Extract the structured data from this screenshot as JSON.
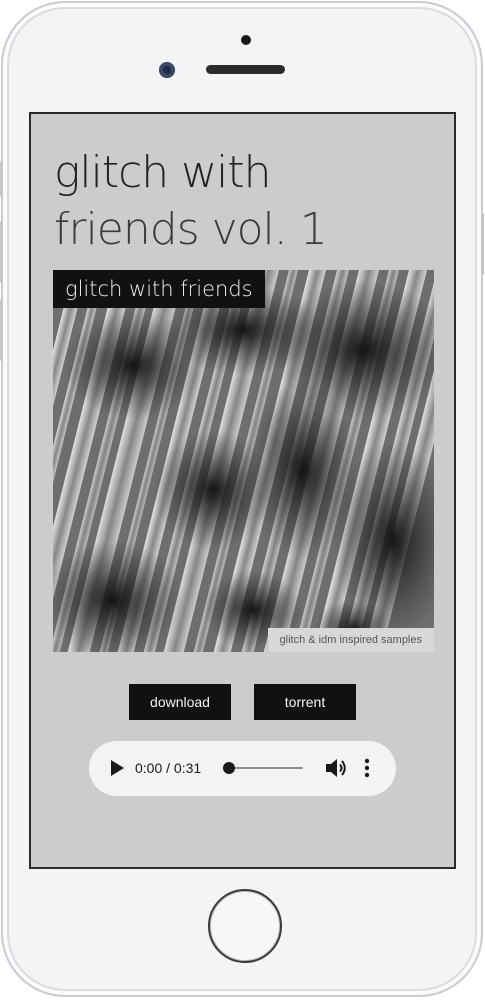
{
  "album": {
    "title_line1": "glitch with",
    "title_line2": "friends vol. 1",
    "cover_label": "glitch with friends",
    "cover_caption": "glitch & idm inspired samples"
  },
  "actions": {
    "download_label": "download",
    "torrent_label": "torrent"
  },
  "player": {
    "time_display": "0:00 / 0:31",
    "progress": 0,
    "icons": [
      "play-icon",
      "volume-icon",
      "more-options-icon"
    ]
  },
  "colors": {
    "screen_background": "#cccccc",
    "button_background": "#111111",
    "button_text": "#f5f5f5",
    "player_background": "#f1f3f4"
  }
}
